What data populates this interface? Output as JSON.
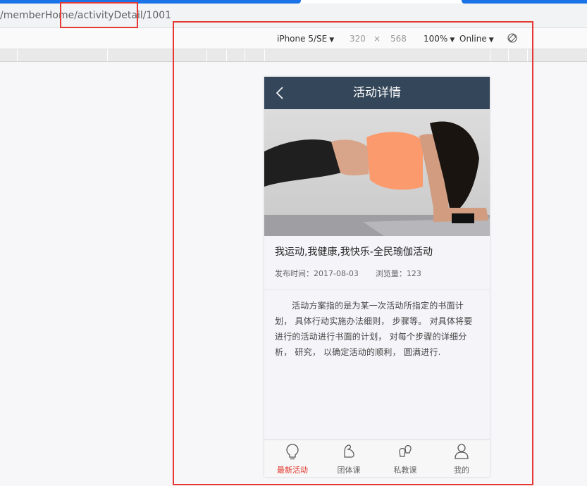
{
  "browser": {
    "url": "/memberHome/activityDetail/1001",
    "device": "iPhone 5/SE",
    "width": "320",
    "times": "×",
    "height": "568",
    "zoom": "100%",
    "network": "Online"
  },
  "app": {
    "nav_title": "活动详情",
    "article": {
      "title": "我运动,我健康,我快乐-全民瑜伽活动",
      "publish_label": "发布时间：",
      "publish_date": "2017-08-03",
      "views_label": "浏览量：",
      "views_count": "123",
      "body": "活动方案指的是为某一次活动所指定的书面计划， 具体行动实施办法细则， 步骤等。 对具体将要进行的活动进行书面的计划， 对每个步骤的详细分析， 研究， 以确定活动的顺利， 圆满进行."
    },
    "tabbar": [
      {
        "label": "最新活动",
        "icon": "lightbulb-icon",
        "active": true
      },
      {
        "label": "团体课",
        "icon": "flexed-arm-icon",
        "active": false
      },
      {
        "label": "私教课",
        "icon": "boxing-gloves-icon",
        "active": false
      },
      {
        "label": "我的",
        "icon": "user-icon",
        "active": false
      }
    ]
  },
  "colors": {
    "nav_bg": "#344659",
    "active_tab": "#e2352d",
    "highlight": "#e53935"
  }
}
